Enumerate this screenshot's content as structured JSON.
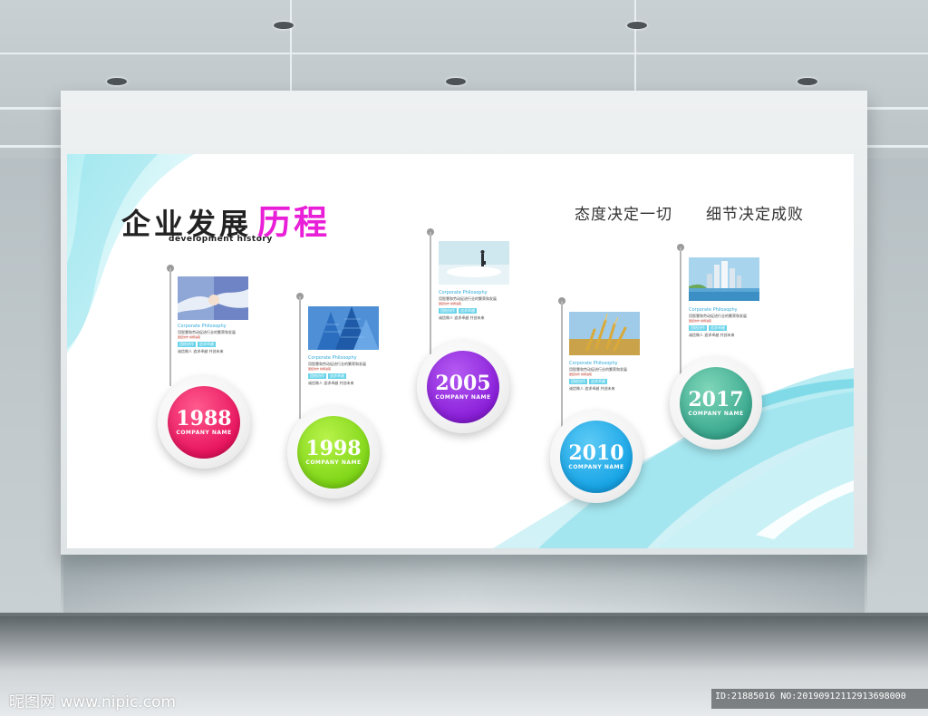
{
  "board": {
    "title_main": "企业发展",
    "title_highlight": "历程",
    "subtitle": "development history",
    "slogans": [
      "态度决定一切",
      "细节决定成败"
    ]
  },
  "timeline": [
    {
      "year": "1988",
      "company": "COMPANY  NAME",
      "heading": "Corporate Philosophy",
      "text": "用智慧和劳动促进行业的繁荣和发展",
      "tiny": "团结协作  拼搏进取",
      "tags": [
        "团结协作",
        "追求卓越"
      ],
      "footer": "诚信做人 追求卓越 共创未来",
      "color": "#e8145e",
      "photo": "handshake-photo"
    },
    {
      "year": "1998",
      "company": "COMPANY  NAME",
      "heading": "Corporate Philosophy",
      "text": "用智慧和劳动促进行业的繁荣和发展",
      "tiny": "团结协作  拼搏进取",
      "tags": [
        "团结协作",
        "追求卓越"
      ],
      "footer": "诚信做人 追求卓越 共创未来",
      "color": "#7fd617",
      "photo": "skyscraper-photo"
    },
    {
      "year": "2005",
      "company": "COMPANY  NAME",
      "heading": "Corporate Philosophy",
      "text": "用智慧和劳动促进行业的繁荣和发展",
      "tiny": "团结协作  拼搏进取",
      "tags": [
        "团结协作",
        "追求卓越"
      ],
      "footer": "诚信做人 追求卓越 共创未来",
      "color": "#8a1fd9",
      "photo": "businessman-photo"
    },
    {
      "year": "2010",
      "company": "COMPANY  NAME",
      "heading": "Corporate Philosophy",
      "text": "用智慧和劳动促进行业的繁荣和发展",
      "tiny": "团结协作  拼搏进取",
      "tags": [
        "团结协作",
        "追求卓越"
      ],
      "footer": "诚信做人 追求卓越 共创未来",
      "color": "#17a4e6",
      "photo": "wheat-photo"
    },
    {
      "year": "2017",
      "company": "COMPANY  NAME",
      "heading": "Corporate Philosophy",
      "text": "用智慧和劳动促进行业的繁荣和发展",
      "tiny": "团结协作  拼搏进取",
      "tags": [
        "团结协作",
        "追求卓越"
      ],
      "footer": "诚信做人 追求卓越 共创未来",
      "color": "#3aa98f",
      "photo": "city-skyline-photo"
    }
  ],
  "watermark": {
    "left": "昵图网 www.nipic.com",
    "right": "ID:21885016 NO:20190912112913698000"
  },
  "colors": {
    "wave_cyan": "#7fdde9",
    "title_pink": "#e91fd8"
  }
}
